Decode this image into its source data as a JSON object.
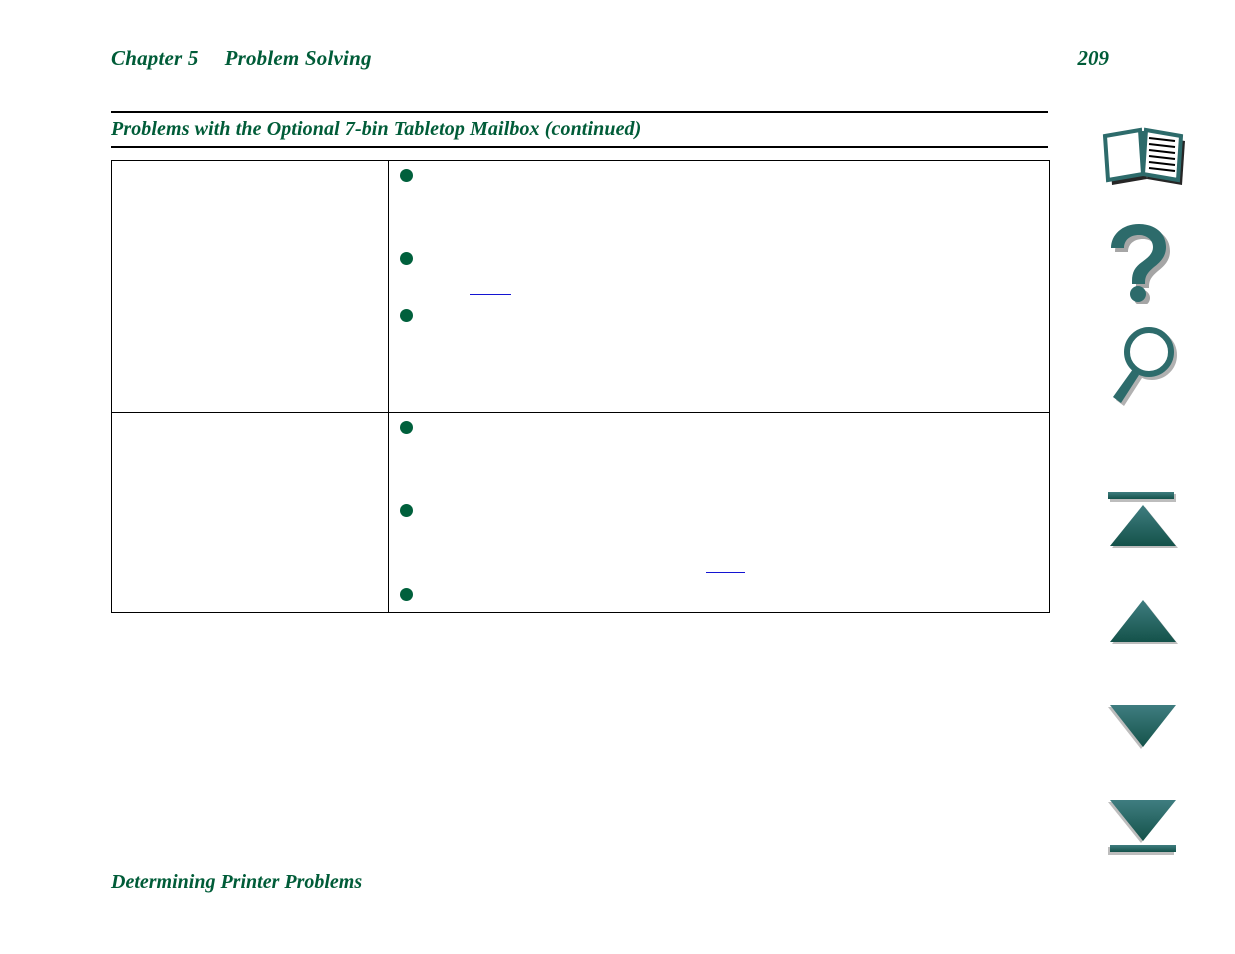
{
  "document": {
    "header": {
      "chapter_label": "Chapter 5",
      "chapter_title": "Problem Solving",
      "page_number": "209"
    },
    "section": {
      "title": "Problems with the Optional 7-bin Tabletop Mailbox (continued)"
    },
    "footer": {
      "title": "Determining Printer Problems"
    }
  },
  "table": {
    "rows": [
      {
        "problem": "",
        "solutions": [
          "",
          "",
          ""
        ]
      },
      {
        "problem": "",
        "solutions": [
          "",
          "",
          ""
        ]
      }
    ]
  },
  "sidebar": {
    "buttons": [
      {
        "name": "contents",
        "icon": "book-icon",
        "label": "Contents"
      },
      {
        "name": "help",
        "icon": "question-mark-icon",
        "label": "Help"
      },
      {
        "name": "search",
        "icon": "magnifier-icon",
        "label": "Search"
      },
      {
        "name": "first-page",
        "icon": "triangle-up-bar-icon",
        "label": "First Page"
      },
      {
        "name": "previous-page",
        "icon": "triangle-up-icon",
        "label": "Previous Page"
      },
      {
        "name": "next-page",
        "icon": "triangle-down-icon",
        "label": "Next Page"
      },
      {
        "name": "last-page",
        "icon": "triangle-down-bar-icon",
        "label": "Last Page"
      }
    ]
  },
  "colors": {
    "heading_green": "#005c38",
    "bullet_green": "#00603c",
    "icon_teal": "#2d6b6b",
    "link_blue": "#1414d2",
    "rule_black": "#000000"
  }
}
